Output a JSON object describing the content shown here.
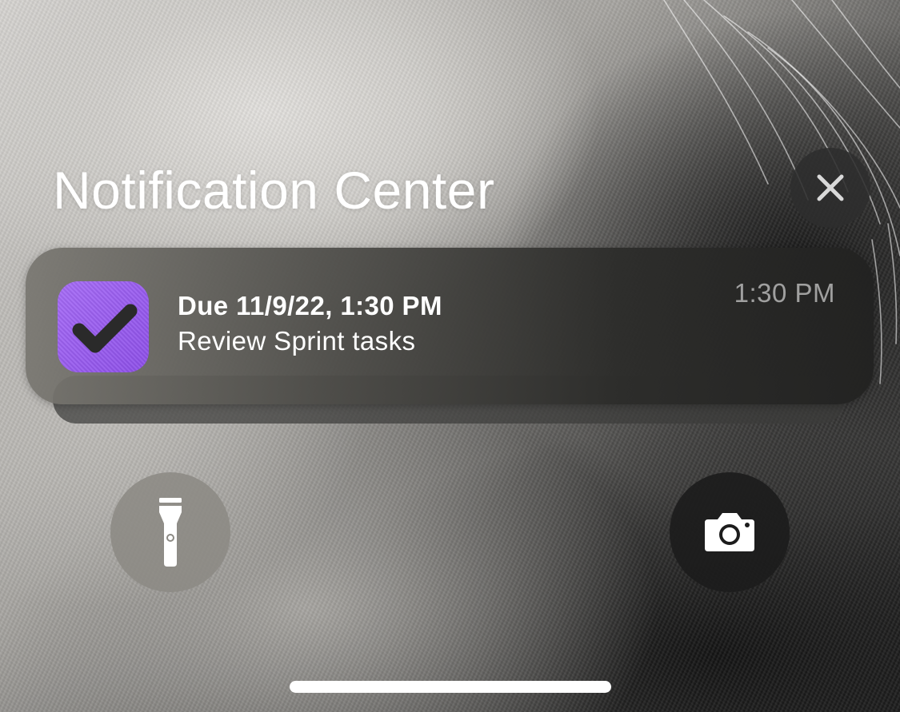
{
  "screen": {
    "title": "Notification Center"
  },
  "close_button": {
    "icon": "close-icon",
    "color": "#2d2d2d"
  },
  "notification": {
    "app_icon": "checkmark-icon",
    "app_icon_color": "#9b5ef2",
    "title": "Due 11/9/22, 1:30 PM",
    "body": "Review Sprint tasks",
    "time": "1:30 PM"
  },
  "quick_actions": {
    "flashlight": {
      "icon": "flashlight-icon"
    },
    "camera": {
      "icon": "camera-icon"
    }
  },
  "home_indicator": {
    "color": "#ffffff"
  }
}
